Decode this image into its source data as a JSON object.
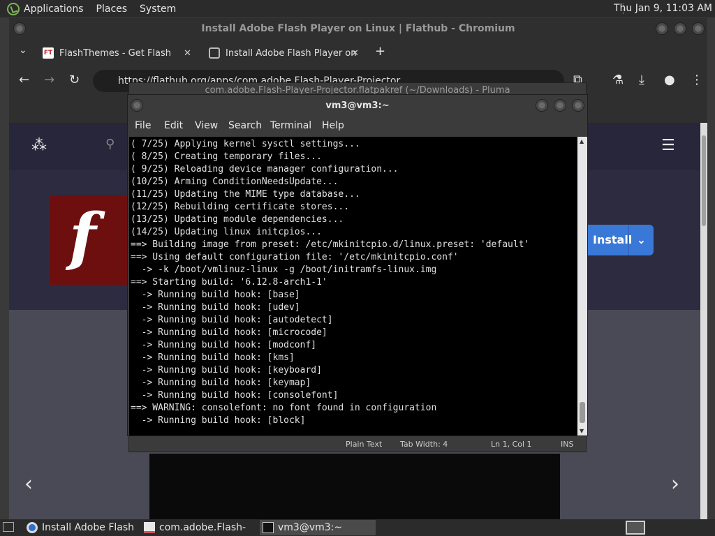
{
  "top_panel": {
    "menus": [
      "Applications",
      "Places",
      "System"
    ],
    "clock": "Thu Jan  9, 11:03 AM"
  },
  "chromium": {
    "title": "Install Adobe Flash Player on Linux | Flathub - Chromium",
    "tabs": [
      {
        "label": "FlashThemes - Get Flash",
        "favicon": "flashthemes-icon"
      },
      {
        "label": "Install Adobe Flash Player on",
        "favicon": "flathub-icon"
      }
    ],
    "url": "https://flathub.org/apps/com.adobe.Flash-Player-Projector",
    "page": {
      "install_label": "Install",
      "flash_glyph": "f"
    }
  },
  "pluma": {
    "title": "com.adobe.Flash-Player-Projector.flatpakref (~/Downloads) - Pluma",
    "status": {
      "mode": "Plain Text",
      "tab_width": "Tab Width:  4",
      "position": "Ln 1, Col 1",
      "insert": "INS"
    }
  },
  "terminal": {
    "title": "vm3@vm3:~",
    "menu": [
      "File",
      "Edit",
      "View",
      "Search",
      "Terminal",
      "Help"
    ],
    "lines": [
      "( 7/25) Applying kernel sysctl settings...",
      "( 8/25) Creating temporary files...",
      "( 9/25) Reloading device manager configuration...",
      "(10/25) Arming ConditionNeedsUpdate...",
      "(11/25) Updating the MIME type database...",
      "(12/25) Rebuilding certificate stores...",
      "(13/25) Updating module dependencies...",
      "(14/25) Updating linux initcpios...",
      "==> Building image from preset: /etc/mkinitcpio.d/linux.preset: 'default'",
      "==> Using default configuration file: '/etc/mkinitcpio.conf'",
      "  -> -k /boot/vmlinuz-linux -g /boot/initramfs-linux.img",
      "==> Starting build: '6.12.8-arch1-1'",
      "  -> Running build hook: [base]",
      "  -> Running build hook: [udev]",
      "  -> Running build hook: [autodetect]",
      "  -> Running build hook: [microcode]",
      "  -> Running build hook: [modconf]",
      "  -> Running build hook: [kms]",
      "  -> Running build hook: [keyboard]",
      "  -> Running build hook: [keymap]",
      "  -> Running build hook: [consolefont]",
      "==> WARNING: consolefont: no font found in configuration",
      "  -> Running build hook: [block]"
    ]
  },
  "taskbar": {
    "tasks": [
      {
        "label": "Install Adobe Flash ...",
        "icon": "chromium-icon"
      },
      {
        "label": "com.adobe.Flash-Pl...",
        "icon": "text-editor-icon"
      },
      {
        "label": "vm3@vm3:~",
        "icon": "terminal-icon"
      }
    ]
  },
  "colors": {
    "flash_red": "#6d0f0f",
    "install_blue": "#3a78d8",
    "flathub_nav": "#27263a"
  }
}
